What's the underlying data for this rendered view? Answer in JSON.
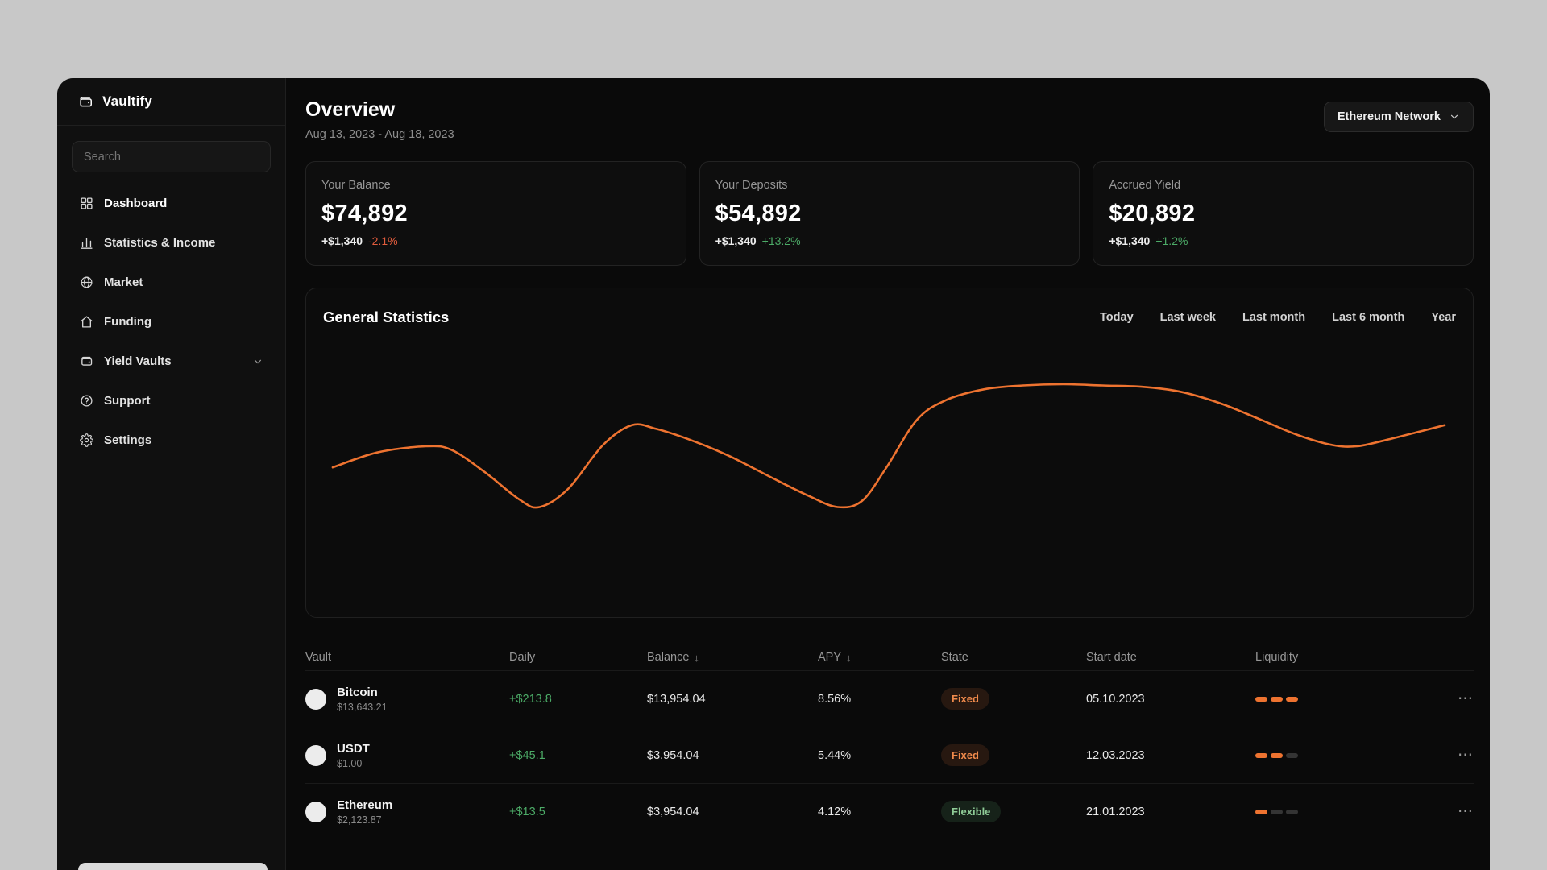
{
  "app": {
    "name": "Vaultify"
  },
  "sidebar": {
    "search": {
      "placeholder": "Search"
    },
    "items": [
      {
        "label": "Dashboard",
        "icon": "dashboard-grid-icon",
        "active": true
      },
      {
        "label": "Statistics & Income",
        "icon": "bar-chart-icon"
      },
      {
        "label": "Market",
        "icon": "globe-icon"
      },
      {
        "label": "Funding",
        "icon": "home-icon"
      },
      {
        "label": "Yield Vaults",
        "icon": "wallet-icon",
        "has_chevron": true
      },
      {
        "label": "Support",
        "icon": "help-circle-icon"
      },
      {
        "label": "Settings",
        "icon": "gear-icon"
      }
    ]
  },
  "header": {
    "title": "Overview",
    "date_range": "Aug 13, 2023 - Aug 18, 2023",
    "network_selector": {
      "label": "Ethereum Network"
    }
  },
  "stat_cards": [
    {
      "label": "Your Balance",
      "value": "$74,892",
      "change": "+$1,340",
      "percent": "-2.1%",
      "trend": "down"
    },
    {
      "label": "Your Deposits",
      "value": "$54,892",
      "change": "+$1,340",
      "percent": "+13.2%",
      "trend": "up"
    },
    {
      "label": "Accrued Yield",
      "value": "$20,892",
      "change": "+$1,340",
      "percent": "+1.2%",
      "trend": "up"
    }
  ],
  "statistics_panel": {
    "title": "General Statistics",
    "filters": [
      {
        "label": "Today"
      },
      {
        "label": "Last week"
      },
      {
        "label": "Last month"
      },
      {
        "label": "Last 6 month"
      },
      {
        "label": "Year"
      }
    ]
  },
  "chart_data": {
    "type": "line",
    "title": "General Statistics",
    "xlabel": "",
    "ylabel": "",
    "grid": false,
    "legend": false,
    "line_color": "#ee7330",
    "x_range": [
      0,
      1
    ],
    "y_range": [
      0,
      100
    ],
    "series": [
      {
        "name": "",
        "x": [
          0,
          0.04,
          0.084,
          0.107,
          0.137,
          0.168,
          0.186,
          0.212,
          0.243,
          0.269,
          0.291,
          0.322,
          0.357,
          0.392,
          0.428,
          0.454,
          0.476,
          0.498,
          0.525,
          0.551,
          0.586,
          0.621,
          0.657,
          0.692,
          0.727,
          0.762,
          0.797,
          0.833,
          0.868,
          0.899,
          0.921,
          0.947,
          0.978,
          1
        ],
        "values": [
          33,
          45,
          50,
          47,
          29,
          7,
          1,
          16,
          51,
          67,
          64,
          55,
          42,
          26,
          10,
          1,
          6,
          33,
          71,
          87,
          96,
          99,
          100,
          99,
          98,
          94,
          85,
          72,
          59,
          51,
          50,
          55,
          62,
          67
        ]
      }
    ]
  },
  "vault_table": {
    "columns": [
      {
        "label": "Vault"
      },
      {
        "label": "Daily"
      },
      {
        "label": "Balance",
        "sort_icon": "↓"
      },
      {
        "label": "APY",
        "sort_icon": "↓"
      },
      {
        "label": "State"
      },
      {
        "label": "Start date"
      },
      {
        "label": "Liquidity"
      }
    ],
    "rows": [
      {
        "name": "Bitcoin",
        "price": "$13,643.21",
        "daily": "+$213.8",
        "balance": "$13,954.04",
        "apy": "8.56%",
        "state": "Fixed",
        "state_style": "fixed",
        "start_date": "05.10.2023",
        "liquidity_level": 3,
        "liquidity_total": 3,
        "menu": "⋯"
      },
      {
        "name": "USDT",
        "price": "$1.00",
        "daily": "+$45.1",
        "balance": "$3,954.04",
        "apy": "5.44%",
        "state": "Fixed",
        "state_style": "fixed",
        "start_date": "12.03.2023",
        "liquidity_level": 2,
        "liquidity_total": 3,
        "menu": "⋯"
      },
      {
        "name": "Ethereum",
        "price": "$2,123.87",
        "daily": "+$13.5",
        "balance": "$3,954.04",
        "apy": "4.12%",
        "state": "Flexible",
        "state_style": "flexible",
        "start_date": "21.01.2023",
        "liquidity_level": 1,
        "liquidity_total": 3,
        "menu": "⋯"
      }
    ]
  },
  "colors": {
    "accent_orange": "#ee7330",
    "positive_green": "#4cab67",
    "negative_red": "#e25c3d",
    "badge_fixed_text": "#f08a4b",
    "badge_flexible_text": "#8ecb96",
    "window_bg": "#0a0a0a",
    "desktop_bg": "#c8c8c8"
  }
}
